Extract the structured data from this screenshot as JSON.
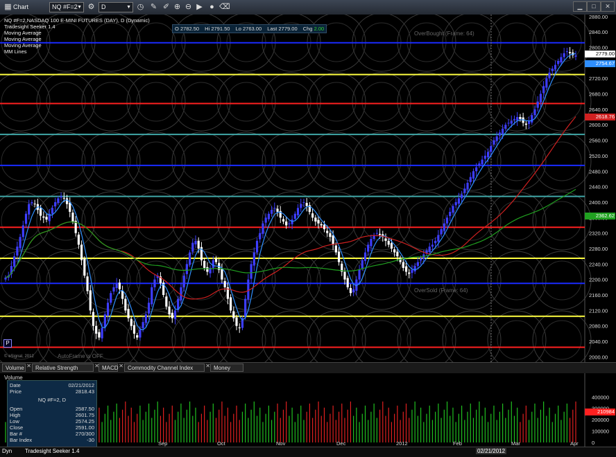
{
  "toolbar": {
    "app_title": "Chart",
    "symbol_value": "NQ #F=2",
    "interval_value": "D"
  },
  "header": {
    "line1": "NQ #F=2,NASDAQ 100 E-MINI FUTURES (DAY), D (Dynamic)",
    "line2": "Tradesight Seeker 1.4",
    "line3": "Moving Average",
    "line4": "Moving Average",
    "line5": "Moving Average",
    "line6": "MM Lines"
  },
  "quote": {
    "o_label": "O",
    "o_value": "2782.50",
    "h_label": "Hi",
    "h_value": "2791.50",
    "l_label": "Lo",
    "l_value": "2763.00",
    "last_label": "Last",
    "last_value": "2779.00",
    "chg_label": "Chg",
    "chg_value": "2.00"
  },
  "annotations": {
    "overbought": "OverBought (Frame: 64)",
    "oversold": "OverSold (Frame: 64)",
    "autoframe": "AutoFrame is OFF",
    "copyright": "© eSignal, 2012",
    "p_marker": "P"
  },
  "price_tags": {
    "last": "2779.00",
    "ma_fast": "2754.67",
    "ma_mid": "2618.76",
    "ma_slow": "2362.62"
  },
  "tabs": [
    {
      "label": "Volume"
    },
    {
      "label": "Relative Strength Index"
    },
    {
      "label": "MACD"
    },
    {
      "label": "Commodity Channel Index (CCI)"
    },
    {
      "label": "Money Flow"
    }
  ],
  "volume_panel": {
    "title": "Volume",
    "tag": "210984"
  },
  "databox": {
    "date_label": "Date",
    "date_value": "02/21/2012",
    "price_label": "Price",
    "price_value": "2818.43",
    "symbol_line": "NQ #F=2, D",
    "open_label": "Open",
    "open_value": "2587.50",
    "high_label": "High",
    "high_value": "2601.75",
    "low_label": "Low",
    "low_value": "2574.25",
    "close_label": "Close",
    "close_value": "2591.00",
    "bar_label": "Bar #",
    "bar_value": "270/300",
    "barindex_label": "Bar Index",
    "barindex_value": "-30"
  },
  "bottom": {
    "left_label": "Dyn",
    "study_label": "Tradesight Seeker 1.4",
    "cursor_date": "02/21/2012"
  },
  "colors": {
    "up": "#3d3dff",
    "down": "#ffffff",
    "overbought_line": "#1a2bff",
    "yellow_line": "#ffff40",
    "red_line": "#ff2020",
    "teal_line": "#40a8a8",
    "ma_fast": "#2f8fff",
    "ma_mid": "#d02020",
    "ma_slow": "#20a020"
  },
  "chart_data": {
    "type": "candlestick",
    "y_axis": {
      "ticks": [
        2000,
        2040,
        2080,
        2120,
        2160,
        2200,
        2240,
        2280,
        2320,
        2360,
        2400,
        2440,
        2480,
        2520,
        2560,
        2600,
        2640,
        2680,
        2720,
        2760,
        2800,
        2840,
        2880
      ],
      "range": [
        1990,
        2885
      ]
    },
    "x_axis": {
      "labels": [
        "Sep",
        "Oct",
        "Nov",
        "Dec",
        "2012",
        "Feb",
        "Mar",
        "Apr"
      ]
    },
    "horizontal_lines": [
      {
        "price": 2812,
        "color": "#1a2bff"
      },
      {
        "price": 2730,
        "color": "#ffff40"
      },
      {
        "price": 2655,
        "color": "#ff2020"
      },
      {
        "price": 2575,
        "color": "#40a8a8"
      },
      {
        "price": 2495,
        "color": "#1a2bff"
      },
      {
        "price": 2415,
        "color": "#40a8a8"
      },
      {
        "price": 2335,
        "color": "#ff2020"
      },
      {
        "price": 2255,
        "color": "#ffff40"
      },
      {
        "price": 2190,
        "color": "#1a2bff"
      },
      {
        "price": 2105,
        "color": "#ffff40"
      },
      {
        "price": 2025,
        "color": "#ff2020"
      }
    ],
    "close": [
      2205,
      2210,
      2235,
      2260,
      2285,
      2310,
      2340,
      2370,
      2395,
      2400,
      2395,
      2380,
      2365,
      2360,
      2355,
      2370,
      2385,
      2400,
      2410,
      2415,
      2410,
      2395,
      2375,
      2350,
      2320,
      2290,
      2250,
      2210,
      2170,
      2120,
      2080,
      2060,
      2050,
      2075,
      2110,
      2140,
      2165,
      2180,
      2190,
      2175,
      2150,
      2120,
      2100,
      2080,
      2060,
      2050,
      2070,
      2090,
      2110,
      2140,
      2180,
      2200,
      2210,
      2190,
      2160,
      2130,
      2110,
      2100,
      2120,
      2150,
      2180,
      2210,
      2240,
      2270,
      2295,
      2300,
      2280,
      2250,
      2230,
      2220,
      2230,
      2250,
      2245,
      2225,
      2200,
      2180,
      2150,
      2120,
      2100,
      2080,
      2075,
      2100,
      2150,
      2200,
      2240,
      2270,
      2300,
      2320,
      2345,
      2360,
      2370,
      2380,
      2385,
      2375,
      2360,
      2350,
      2340,
      2345,
      2355,
      2370,
      2385,
      2395,
      2400,
      2390,
      2375,
      2360,
      2350,
      2345,
      2340,
      2330,
      2320,
      2310,
      2290,
      2270,
      2245,
      2220,
      2200,
      2180,
      2165,
      2175,
      2200,
      2225,
      2250,
      2270,
      2290,
      2305,
      2315,
      2320,
      2315,
      2310,
      2300,
      2290,
      2280,
      2270,
      2260,
      2245,
      2230,
      2220,
      2215,
      2225,
      2235,
      2245,
      2255,
      2265,
      2275,
      2285,
      2290,
      2300,
      2315,
      2330,
      2345,
      2360,
      2375,
      2390,
      2400,
      2410,
      2420,
      2435,
      2450,
      2465,
      2480,
      2490,
      2500,
      2510,
      2520,
      2530,
      2545,
      2560,
      2570,
      2580,
      2590,
      2600,
      2605,
      2610,
      2615,
      2620,
      2615,
      2605,
      2600,
      2610,
      2625,
      2640,
      2660,
      2680,
      2700,
      2720,
      2735,
      2745,
      2755,
      2765,
      2775,
      2785,
      2790,
      2785,
      2780,
      2779
    ],
    "ma_fast_last": 2754.67,
    "ma_mid_last": 2618.76,
    "ma_slow_last": 2362.62,
    "volume_axis_ticks": [
      0,
      100000,
      200000,
      300000,
      400000
    ],
    "volume_range": [
      0,
      560000
    ]
  }
}
